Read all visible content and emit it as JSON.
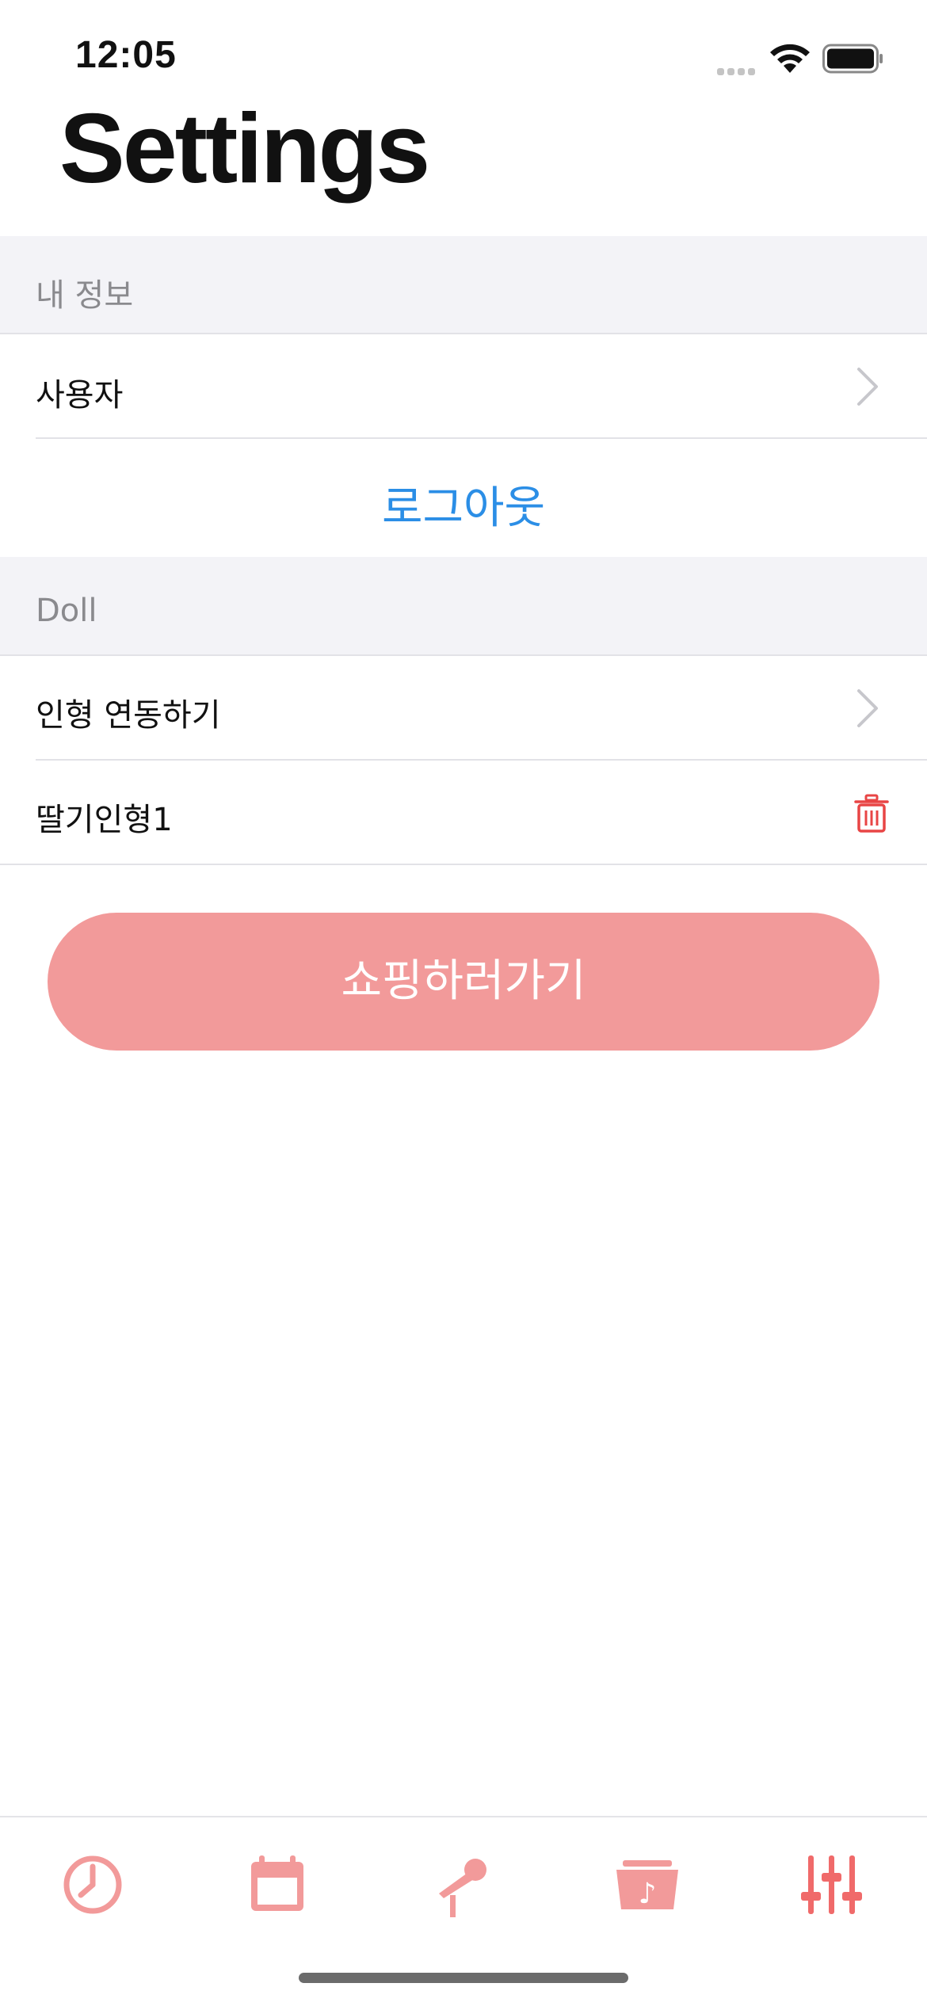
{
  "status_bar": {
    "time": "12:05"
  },
  "page": {
    "title": "Settings"
  },
  "sections": {
    "my_info": {
      "header": "내 정보",
      "user_label": "사용자",
      "logout_label": "로그아웃"
    },
    "doll": {
      "header": "Doll",
      "link_label": "인형 연동하기",
      "doll_name": "딸기인형1"
    }
  },
  "shop_button": {
    "label": "쇼핑하러가기"
  },
  "tab_bar": {
    "tabs": [
      {
        "icon": "clock-icon",
        "selected": false
      },
      {
        "icon": "calendar-icon",
        "selected": false
      },
      {
        "icon": "microphone-icon",
        "selected": false
      },
      {
        "icon": "music-folder-icon",
        "selected": false
      },
      {
        "icon": "sliders-icon",
        "selected": true
      }
    ]
  },
  "colors": {
    "accent_pink": "#f29a9a",
    "accent_pink_selected": "#f06a6a",
    "link_blue": "#2b8ee6",
    "delete_red": "#e84545",
    "section_bg": "#f3f3f7",
    "secondary_text": "#8a8a8e"
  }
}
